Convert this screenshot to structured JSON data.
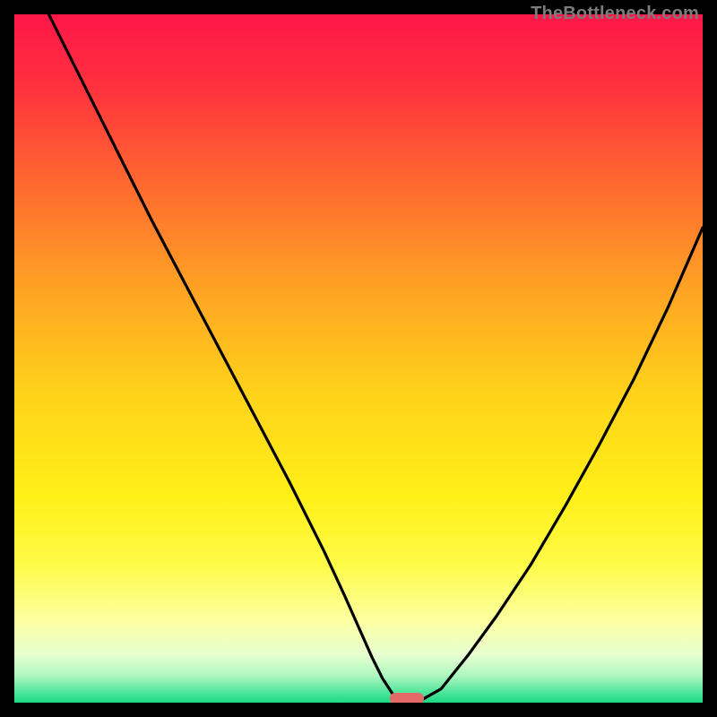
{
  "watermark": "TheBottleneck.com",
  "colors": {
    "frame": "#000000",
    "curve": "#000000",
    "marker": "#e46a6a",
    "gradient_stops": [
      {
        "offset": 0.0,
        "color": "#ff1749"
      },
      {
        "offset": 0.1,
        "color": "#ff2f3f"
      },
      {
        "offset": 0.25,
        "color": "#ff6a2f"
      },
      {
        "offset": 0.4,
        "color": "#ffa324"
      },
      {
        "offset": 0.55,
        "color": "#ffd21a"
      },
      {
        "offset": 0.7,
        "color": "#fff018"
      },
      {
        "offset": 0.8,
        "color": "#fffb48"
      },
      {
        "offset": 0.88,
        "color": "#fcffa0"
      },
      {
        "offset": 0.93,
        "color": "#e8ffd0"
      },
      {
        "offset": 0.96,
        "color": "#b0f7c0"
      },
      {
        "offset": 0.985,
        "color": "#4fe59a"
      },
      {
        "offset": 1.0,
        "color": "#1dd884"
      }
    ]
  },
  "chart_data": {
    "type": "line",
    "title": "",
    "xlabel": "",
    "ylabel": "",
    "xlim": [
      0,
      100
    ],
    "ylim": [
      0,
      100
    ],
    "y_inverted_visual": true,
    "series": [
      {
        "name": "bottleneck-curve",
        "x": [
          5,
          10,
          15,
          20,
          25,
          30,
          35,
          40,
          45,
          48,
          50,
          52,
          53.5,
          55,
          57,
          58,
          59,
          62,
          66,
          70,
          75,
          80,
          85,
          90,
          95,
          100
        ],
        "y": [
          100,
          90,
          80,
          70,
          60.5,
          51,
          41.5,
          32,
          22,
          15.5,
          11,
          6.5,
          3.5,
          1.2,
          0.3,
          0.15,
          0.3,
          2.0,
          7,
          12.5,
          20,
          28.5,
          37.5,
          47,
          57.5,
          69
        ]
      }
    ],
    "marker": {
      "x_start": 54.5,
      "x_end": 59.5,
      "y": 0.6
    }
  }
}
